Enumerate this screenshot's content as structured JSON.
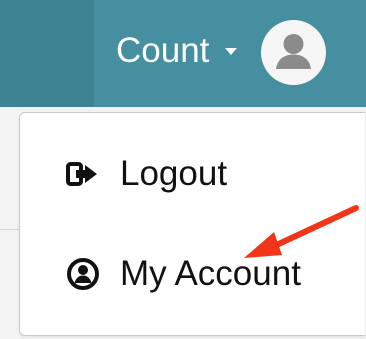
{
  "navbar": {
    "user_name": "Count",
    "caret_icon": "caret-down-icon",
    "avatar_icon": "user-avatar-icon",
    "background_color": "#468fa0"
  },
  "dropdown": {
    "items": [
      {
        "label": "Logout",
        "icon": "sign-out-icon"
      },
      {
        "label": "My Account",
        "icon": "user-circle-icon"
      }
    ]
  },
  "annotation": {
    "arrow_color": "#f23418",
    "target": "My Account"
  }
}
